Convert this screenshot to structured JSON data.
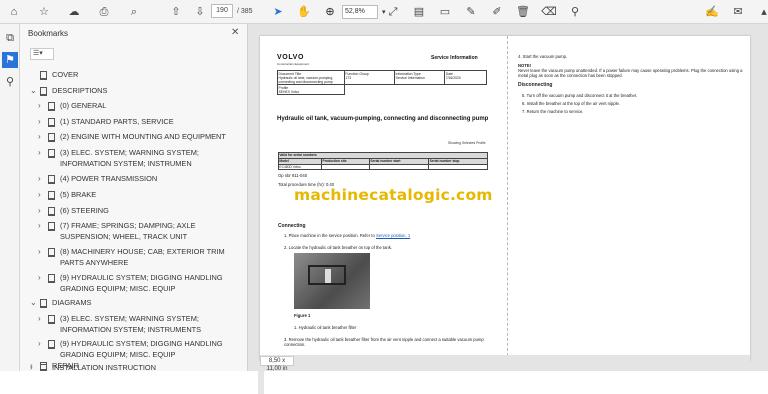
{
  "toolbar": {
    "page_current": "190",
    "page_total": "/ 385",
    "zoom": "52,8%",
    "icons": [
      "home-icon",
      "star-icon",
      "cloud-upload-icon",
      "print-icon",
      "search-icon",
      "arrow-up-icon",
      "arrow-down-icon",
      "cursor-icon",
      "hand-icon",
      "zoom-out-icon",
      "zoom-in-icon",
      "fit-icon",
      "scroll-mode-icon",
      "comment-icon",
      "pen-icon",
      "highlight-icon",
      "delete-icon",
      "stamp-icon",
      "sign-icon",
      "mail-icon"
    ]
  },
  "bookmarks": {
    "title": "Bookmarks",
    "items": [
      {
        "label": "COVER",
        "expandable": false
      },
      {
        "label": "DESCRIPTIONS",
        "expandable": true,
        "expanded": true
      },
      {
        "label": "(0) GENERAL",
        "expandable": true
      },
      {
        "label": "(1) STANDARD PARTS, SERVICE",
        "expandable": true
      },
      {
        "label": "(2) ENGINE WITH MOUNTING AND EQUIPMENT",
        "expandable": true
      },
      {
        "label": "(3) ELEC. SYSTEM; WARNING SYSTEM; INFORMATION SYSTEM; INSTRUMEN",
        "expandable": true
      },
      {
        "label": "(4) POWER TRANSMISSION",
        "expandable": true
      },
      {
        "label": "(5) BRAKE",
        "expandable": true
      },
      {
        "label": "(6) STEERING",
        "expandable": true
      },
      {
        "label": "(7) FRAME; SPRINGS; DAMPING; AXLE SUSPENSION; WHEEL, TRACK UNIT",
        "expandable": true
      },
      {
        "label": "(8) MACHINERY HOUSE; CAB; EXTERIOR TRIM PARTS ANYWHERE",
        "expandable": true
      },
      {
        "label": "(9) HYDRAULIC SYSTEM; DIGGING HANDLING GRADING EQUIPM; MISC. EQUIP",
        "expandable": true
      },
      {
        "label": "DIAGRAMS",
        "expandable": true,
        "expanded": true
      },
      {
        "label": "(3) ELEC. SYSTEM; WARNING SYSTEM; INFORMATION SYSTEM; INSTRUMENTS",
        "expandable": true
      },
      {
        "label": "(9) HYDRAULIC SYSTEM; DIGGING HANDLING GRADING EQUIPM; MISC. EQUIP",
        "expandable": true
      },
      {
        "label": "INSTALLATION INSTRUCTION",
        "expandable": true
      },
      {
        "label": "REPAIR",
        "expandable": true
      }
    ]
  },
  "document": {
    "logo": "VOLVO",
    "logo_sub": "Construction Equipment",
    "header_right": "Service Information",
    "info_table": {
      "headers": [
        "Document Title",
        "Function Group",
        "Information Type",
        "Date"
      ],
      "values": [
        "Hydraulic oil tank, vacuum-pumping, connecting and disconnecting pump",
        "173",
        "Service Information",
        "7/16/2020"
      ],
      "profile_label": "Profile",
      "profile_value": "SEHEX Volvo"
    },
    "title": "Hydraulic oil tank, vacuum-pumping, connecting and disconnecting pump",
    "showing": "Showing Selected Profile",
    "valid_table": {
      "caption": "Valid for serial numbers",
      "headers": [
        "Model",
        "Production site",
        "Serial number start",
        "Serial number stop"
      ],
      "row": [
        "EC480D Volvo",
        "",
        "",
        ""
      ]
    },
    "op_no": "Op nbr 911-040",
    "total_time": "Total procedure time (hr): 0.40",
    "connecting_heading": "Connecting",
    "step1": "1.  Place machine in the service position. Refer to",
    "step1_link": "Service position, 1",
    "step2": "2.  Locate the hydraulic oil tank breather on top of the tank.",
    "figure_label": "Figure 1",
    "figure_caption": "1.    Hydraulic oil tank breather filter",
    "step3": "3.  Remove the hydraulic oil tank breather filter from the air vent nipple and connect a suitable vacuum pump connection.",
    "right_step4": "4.  Start the vacuum pump.",
    "note_label": "NOTE!",
    "note_text": "Never leave the vacuum pump unattended. If a power failure may cause operating problems. Plug the connection using a metal plug as soon as the connection has been stopped.",
    "disconnecting_heading": "Disconnecting",
    "right_step5": "5.  Turn off the vacuum pump and disconnect it at the breather.",
    "right_step6": "6.  Install the breather at the top of the air vent nipple.",
    "right_step7": "7.  Return the machine to service.",
    "watermark": "machinecatalogic.com"
  },
  "status": {
    "page_size": "8,50 x 11,00 in"
  }
}
